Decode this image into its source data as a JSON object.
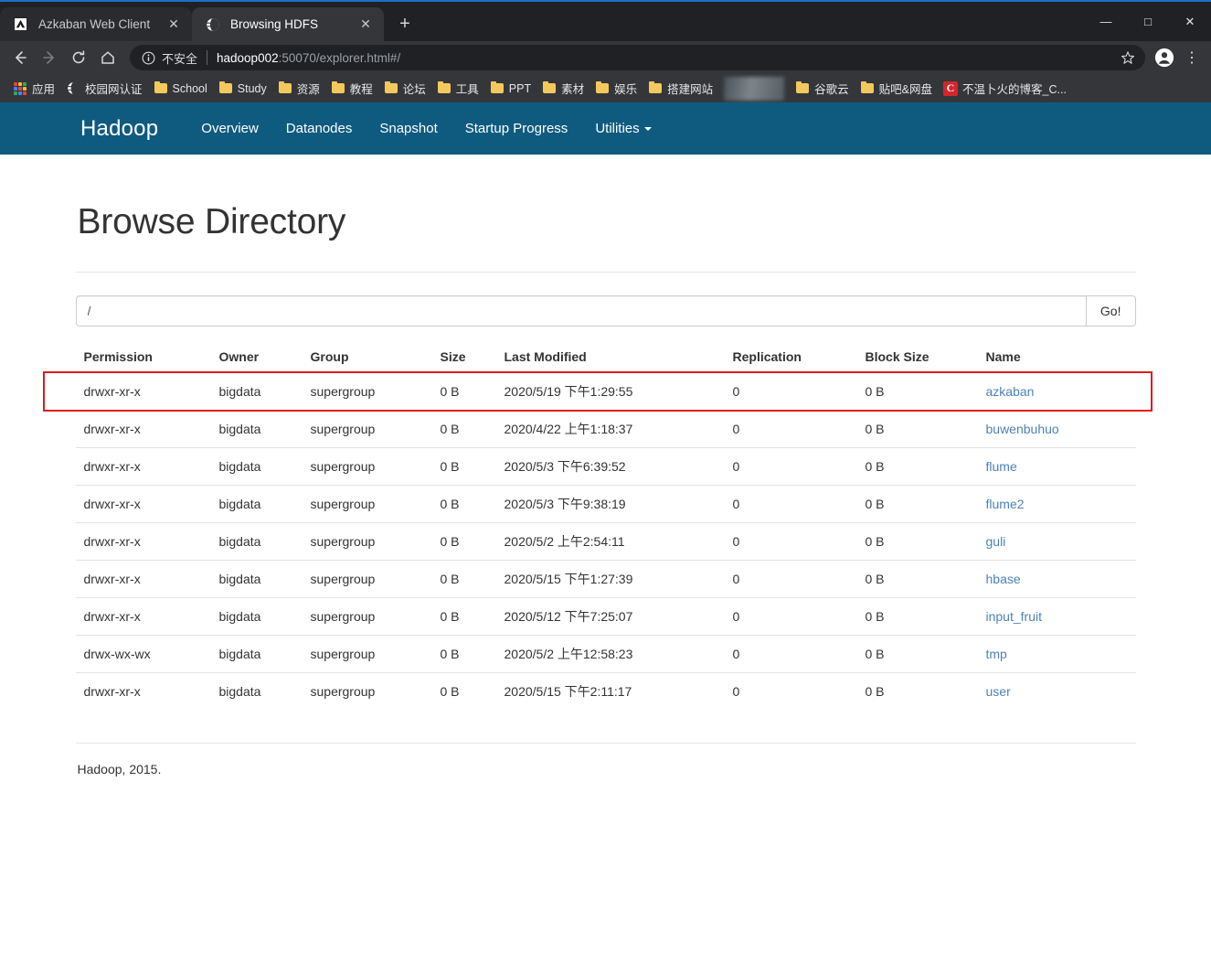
{
  "browser": {
    "tabs": [
      {
        "title": "Azkaban Web Client",
        "favicon": "azkaban-icon",
        "active": false,
        "close_label": "✕"
      },
      {
        "title": "Browsing HDFS",
        "favicon": "globe-icon",
        "active": true,
        "close_label": "✕"
      }
    ],
    "new_tab_label": "+",
    "window_controls": {
      "minimize": "—",
      "maximize": "□",
      "close": "✕"
    },
    "toolbar": {
      "back_label": "←",
      "forward_label": "→",
      "reload_label": "↻",
      "home_label": "⌂",
      "security_text": "不安全",
      "url_host": "hadoop002",
      "url_rest": ":50070/explorer.html#/",
      "url_full": "hadoop002:50070/explorer.html#/",
      "star_label": "☆",
      "profile_label": "●",
      "menu_label": "⋮"
    },
    "bookmarks": [
      {
        "label": "应用",
        "icon": "apps-grid-icon"
      },
      {
        "label": "校园网认证",
        "icon": "globe-icon"
      },
      {
        "label": "School",
        "icon": "folder-icon"
      },
      {
        "label": "Study",
        "icon": "folder-icon"
      },
      {
        "label": "资源",
        "icon": "folder-icon"
      },
      {
        "label": "教程",
        "icon": "folder-icon"
      },
      {
        "label": "论坛",
        "icon": "folder-icon"
      },
      {
        "label": "工具",
        "icon": "folder-icon"
      },
      {
        "label": "PPT",
        "icon": "folder-icon"
      },
      {
        "label": "素材",
        "icon": "folder-icon"
      },
      {
        "label": "娱乐",
        "icon": "folder-icon"
      },
      {
        "label": "搭建网站",
        "icon": "folder-icon"
      },
      {
        "label": "",
        "icon": "censored-icon"
      },
      {
        "label": "谷歌云",
        "icon": "folder-icon"
      },
      {
        "label": "贴吧&网盘",
        "icon": "folder-icon"
      },
      {
        "label": "不温卜火的博客_C...",
        "icon": "csdn-icon"
      }
    ]
  },
  "hadoop": {
    "brand": "Hadoop",
    "nav_items": [
      "Overview",
      "Datanodes",
      "Snapshot",
      "Startup Progress"
    ],
    "dropdown": {
      "label": "Utilities",
      "caret": "caret-down-icon"
    },
    "nav_bg_color": "#0f5b80"
  },
  "main": {
    "page_title": "Browse Directory",
    "path_value": "/",
    "path_placeholder": "",
    "go_label": "Go!",
    "columns": [
      "Permission",
      "Owner",
      "Group",
      "Size",
      "Last Modified",
      "Replication",
      "Block Size",
      "Name"
    ],
    "rows": [
      {
        "permission": "drwxr-xr-x",
        "owner": "bigdata",
        "group": "supergroup",
        "size": "0 B",
        "modified": "2020/5/19 下午1:29:55",
        "replication": "0",
        "block_size": "0 B",
        "name": "azkaban",
        "highlighted": true
      },
      {
        "permission": "drwxr-xr-x",
        "owner": "bigdata",
        "group": "supergroup",
        "size": "0 B",
        "modified": "2020/4/22 上午1:18:37",
        "replication": "0",
        "block_size": "0 B",
        "name": "buwenbuhuo",
        "highlighted": false
      },
      {
        "permission": "drwxr-xr-x",
        "owner": "bigdata",
        "group": "supergroup",
        "size": "0 B",
        "modified": "2020/5/3 下午6:39:52",
        "replication": "0",
        "block_size": "0 B",
        "name": "flume",
        "highlighted": false
      },
      {
        "permission": "drwxr-xr-x",
        "owner": "bigdata",
        "group": "supergroup",
        "size": "0 B",
        "modified": "2020/5/3 下午9:38:19",
        "replication": "0",
        "block_size": "0 B",
        "name": "flume2",
        "highlighted": false
      },
      {
        "permission": "drwxr-xr-x",
        "owner": "bigdata",
        "group": "supergroup",
        "size": "0 B",
        "modified": "2020/5/2 上午2:54:11",
        "replication": "0",
        "block_size": "0 B",
        "name": "guli",
        "highlighted": false
      },
      {
        "permission": "drwxr-xr-x",
        "owner": "bigdata",
        "group": "supergroup",
        "size": "0 B",
        "modified": "2020/5/15 下午1:27:39",
        "replication": "0",
        "block_size": "0 B",
        "name": "hbase",
        "highlighted": false
      },
      {
        "permission": "drwxr-xr-x",
        "owner": "bigdata",
        "group": "supergroup",
        "size": "0 B",
        "modified": "2020/5/12 下午7:25:07",
        "replication": "0",
        "block_size": "0 B",
        "name": "input_fruit",
        "highlighted": false
      },
      {
        "permission": "drwx-wx-wx",
        "owner": "bigdata",
        "group": "supergroup",
        "size": "0 B",
        "modified": "2020/5/2 上午12:58:23",
        "replication": "0",
        "block_size": "0 B",
        "name": "tmp",
        "highlighted": false
      },
      {
        "permission": "drwxr-xr-x",
        "owner": "bigdata",
        "group": "supergroup",
        "size": "0 B",
        "modified": "2020/5/15 下午2:11:17",
        "replication": "0",
        "block_size": "0 B",
        "name": "user",
        "highlighted": false
      }
    ],
    "footer": "Hadoop, 2015.",
    "highlight_color": "#e01b1b",
    "link_color": "#4d82b8"
  }
}
